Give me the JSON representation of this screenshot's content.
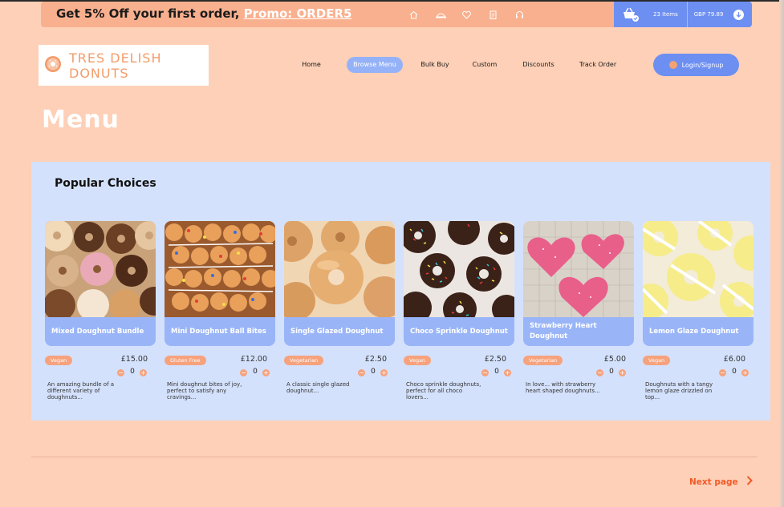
{
  "promo": {
    "text": "Get 5% Off your first order, ",
    "code": "Promo: ORDER5",
    "icons": [
      "home-icon",
      "dish-icon",
      "heart-icon",
      "clipboard-icon",
      "headset-icon"
    ]
  },
  "cart": {
    "items": "23 Items",
    "total": "GBP 79.89"
  },
  "brand": {
    "name": "TRES DELISH DONUTS"
  },
  "nav": {
    "items": [
      {
        "label": "Home",
        "active": false
      },
      {
        "label": "Browse Menu",
        "active": true
      },
      {
        "label": "Bulk Buy",
        "active": false
      },
      {
        "label": "Custom",
        "active": false
      },
      {
        "label": "Discounts",
        "active": false
      },
      {
        "label": "Track Order",
        "active": false
      }
    ],
    "login": "Login/Signup"
  },
  "page": {
    "title": "Menu"
  },
  "popular": {
    "title": "Popular Choices",
    "products": [
      {
        "name": "Mixed Doughnut Bundle",
        "tag": "Vegan",
        "price": "£15.00",
        "qty": "0",
        "desc": "An amazing bundle of a different variety of doughnuts..."
      },
      {
        "name": "Mini Doughnut Ball Bites",
        "tag": "Gluten Free",
        "price": "£12.00",
        "qty": "0",
        "desc": "Mini doughnut bites of joy, perfect to satisfy any cravings..."
      },
      {
        "name": "Single Glazed Doughnut",
        "tag": "Vegetarian",
        "price": "£2.50",
        "qty": "0",
        "desc": "A classic single glazed doughnut..."
      },
      {
        "name": "Choco Sprinkle Doughnut",
        "tag": "Vegan",
        "price": "£2.50",
        "qty": "0",
        "desc": "Choco sprinkle doughnuts, perfect for all choco lovers..."
      },
      {
        "name": "Strawberry Heart Doughnut",
        "tag": "Vegetarian",
        "price": "£5.00",
        "qty": "0",
        "desc": "In love... with strawberry heart shaped doughnuts..."
      },
      {
        "name": "Lemon Glaze Doughnut",
        "tag": "Vegan",
        "price": "£6.00",
        "qty": "0",
        "desc": "Doughnuts with a tangy lemon glaze drizzled on top..."
      }
    ]
  },
  "pagination": {
    "next": "Next page"
  },
  "colors": {
    "background": "#fdd0b7",
    "accent": "#6d8ff2",
    "tag": "#f6a27d",
    "card_band": "#9ab5f7",
    "panel": "#d4e1fc"
  }
}
